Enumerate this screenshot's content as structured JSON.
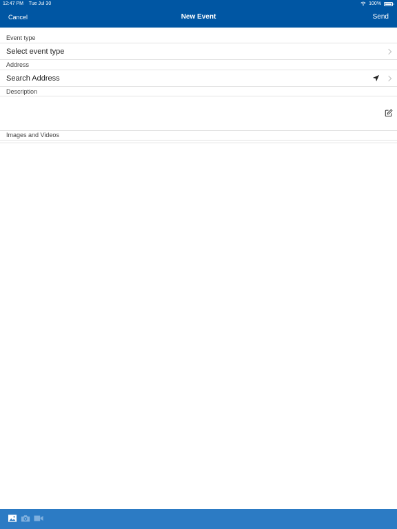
{
  "status_bar": {
    "time": "12:47 PM",
    "date": "Tue Jul 30",
    "battery": "100%"
  },
  "nav": {
    "cancel_label": "Cancel",
    "title": "New Event",
    "send_label": "Send"
  },
  "form": {
    "event_type_label": "Event type",
    "event_type_value": "Select event type",
    "address_label": "Address",
    "address_placeholder": "Search Address",
    "description_label": "Description",
    "media_label": "Images and Videos"
  },
  "toolbar": {
    "icons": [
      "image-icon",
      "camera-icon",
      "video-icon"
    ]
  },
  "colors": {
    "nav_background": "#0056a3",
    "toolbar_background": "#2c7bc4"
  }
}
